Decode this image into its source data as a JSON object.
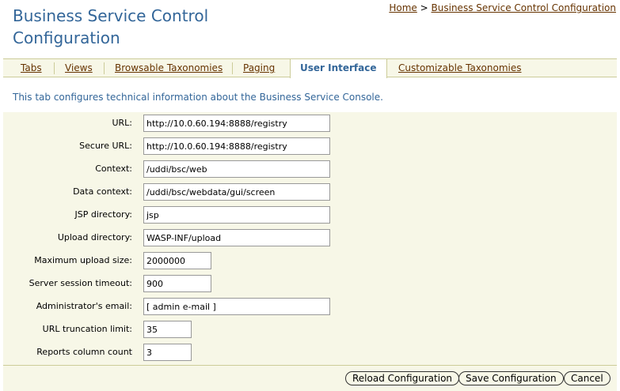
{
  "header": {
    "title_line1": "Business Service Control",
    "title_line2": "Configuration"
  },
  "breadcrumb": {
    "home": "Home",
    "separator": ">",
    "current": "Business Service Control Configuration"
  },
  "tabs": [
    {
      "label": "Tabs",
      "active": false
    },
    {
      "label": "Views",
      "active": false
    },
    {
      "label": "Browsable Taxonomies",
      "active": false
    },
    {
      "label": "Paging",
      "active": false
    },
    {
      "label": "User Interface",
      "active": true
    },
    {
      "label": "Customizable Taxonomies",
      "active": false
    }
  ],
  "instructions": "This tab configures technical information about the Business Service Console.",
  "fields": [
    {
      "label": "URL:",
      "value": "http://10.0.60.194:8888/registry"
    },
    {
      "label": "Secure URL:",
      "value": "http://10.0.60.194:8888/registry"
    },
    {
      "label": "Context:",
      "value": "/uddi/bsc/web"
    },
    {
      "label": "Data context:",
      "value": "/uddi/bsc/webdata/gui/screen"
    },
    {
      "label": "JSP directory:",
      "value": "jsp"
    },
    {
      "label": "Upload directory:",
      "value": "WASP-INF/upload"
    },
    {
      "label": "Maximum upload size:",
      "value": "2000000"
    },
    {
      "label": "Server session timeout:",
      "value": "900"
    },
    {
      "label": "Administrator's email:",
      "value": "[ admin e-mail ]"
    },
    {
      "label": "URL truncation limit:",
      "value": "35"
    },
    {
      "label": "Reports column count",
      "value": "3"
    }
  ],
  "buttons": {
    "reload": "Reload Configuration",
    "save": "Save Configuration",
    "cancel": "Cancel"
  },
  "colors": {
    "title": "#336699",
    "link": "#663300",
    "panel_bg": "#f7f7e7",
    "border": "#cccc99"
  }
}
